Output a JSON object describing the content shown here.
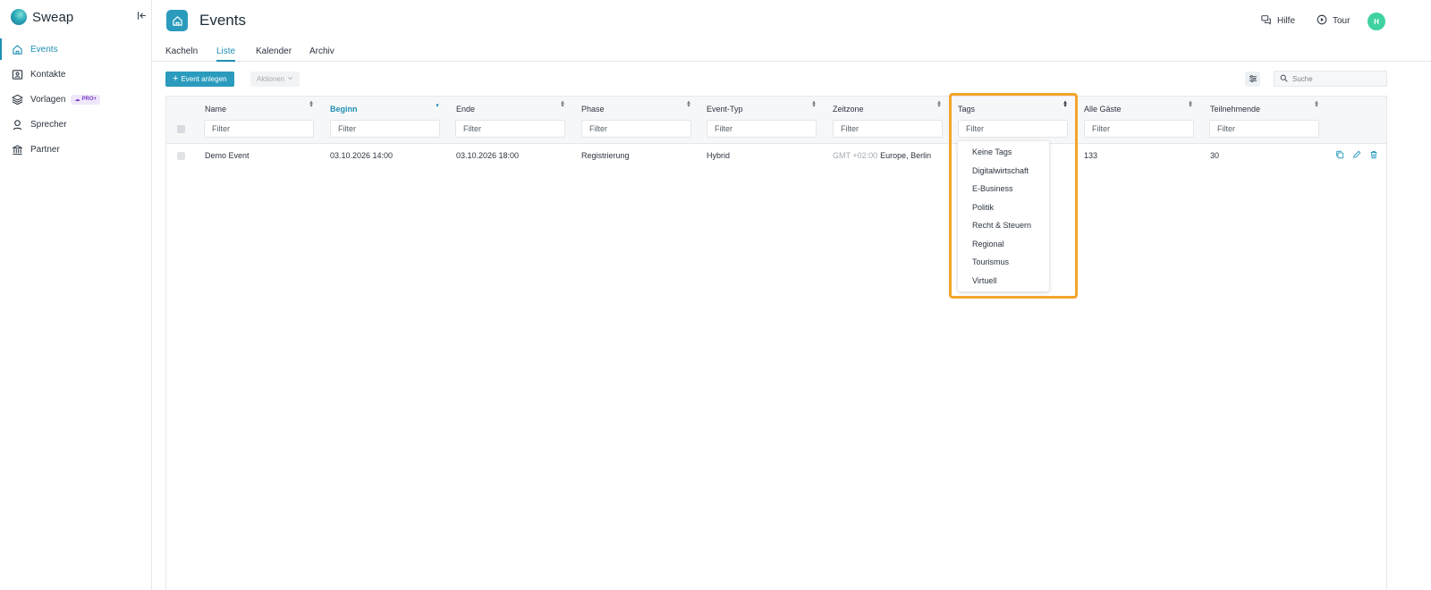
{
  "app": {
    "name": "Sweap"
  },
  "sidebar": {
    "items": [
      {
        "label": "Events",
        "icon": "home-icon",
        "active": true
      },
      {
        "label": "Kontakte",
        "icon": "contacts-icon"
      },
      {
        "label": "Vorlagen",
        "icon": "layers-icon",
        "badge": "PRO+"
      },
      {
        "label": "Sprecher",
        "icon": "speaker-icon"
      },
      {
        "label": "Partner",
        "icon": "bank-icon"
      }
    ]
  },
  "header": {
    "title": "Events",
    "help_label": "Hilfe",
    "tour_label": "Tour",
    "avatar_initial": "H"
  },
  "tabs": [
    {
      "label": "Kacheln"
    },
    {
      "label": "Liste",
      "active": true
    },
    {
      "label": "Kalender"
    },
    {
      "label": "Archiv"
    }
  ],
  "toolbar": {
    "create_label": "Event anlegen",
    "actions_label": "Aktionen",
    "search_placeholder": "Suche"
  },
  "table": {
    "columns": [
      "Name",
      "Beginn",
      "Ende",
      "Phase",
      "Event-Typ",
      "Zeitzone",
      "Tags",
      "Alle Gäste",
      "Teilnehmende"
    ],
    "sorted_column": "Beginn",
    "filter_placeholder": "Filter",
    "rows": [
      {
        "name": "Demo Event",
        "beginn": "03.10.2026 14:00",
        "ende": "03.10.2026 18:00",
        "phase": "Registrierung",
        "event_typ": "Hybrid",
        "zeitzone_offset": "GMT +02:00",
        "zeitzone_name": "Europe, Berlin",
        "alle_gaeste": "133",
        "teilnehmende": "30"
      }
    ]
  },
  "tags_dropdown": {
    "options": [
      "Keine Tags",
      "Digitalwirtschaft",
      "E-Business",
      "Politik",
      "Recht & Steuern",
      "Regional",
      "Tourismus",
      "Virtuell"
    ]
  },
  "colors": {
    "accent": "#2a9bbd",
    "highlight": "#f4a52b",
    "avatar": "#3fd1a0",
    "pro_badge": "#7b3fc8"
  }
}
